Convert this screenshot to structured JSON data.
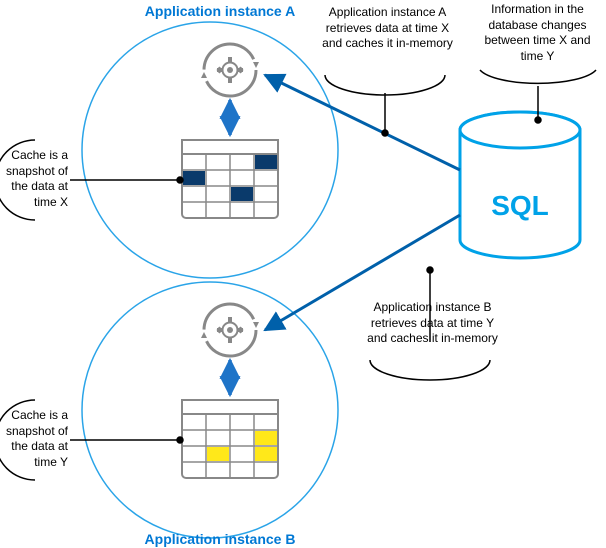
{
  "diagram": {
    "instance_a_title": "Application instance A",
    "instance_b_title": "Application instance B",
    "db_label": "SQL",
    "annotation_cache_x": "Cache is a snapshot of the data at time X",
    "annotation_cache_y": "Cache is a snapshot of the data at time Y",
    "annotation_retrieve_a": "Application instance A retrieves data at time X and caches it in-memory",
    "annotation_retrieve_b": "Application instance B retrieves data at time Y and caches it in-memory",
    "annotation_db_change": "Information in the database changes between time X and time Y"
  }
}
